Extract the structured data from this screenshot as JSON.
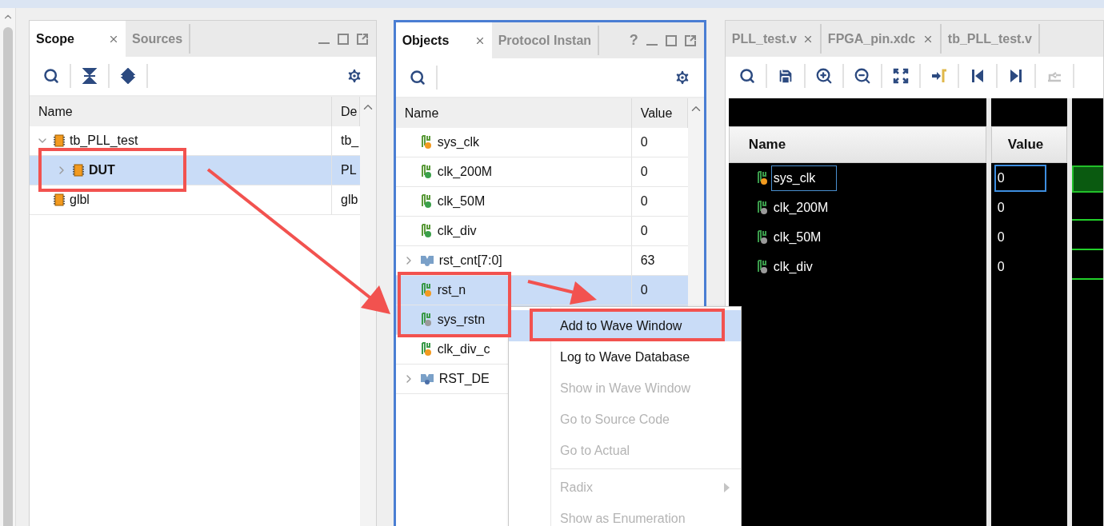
{
  "scope_panel": {
    "tabs": [
      {
        "label": "Scope",
        "selected": true,
        "closable": true
      },
      {
        "label": "Sources",
        "selected": false,
        "closable": false
      }
    ],
    "columns": [
      "Name",
      "De"
    ],
    "rows": [
      {
        "name": "tb_PLL_test",
        "design": "tb_",
        "selected": false,
        "expanded": true,
        "children": [
          {
            "name": "DUT",
            "design": "PL",
            "selected": true,
            "expanded": false
          }
        ]
      },
      {
        "name": "glbl",
        "design": "glb",
        "selected": false
      }
    ]
  },
  "objects_panel": {
    "tabs": [
      {
        "label": "Objects",
        "selected": true,
        "closable": true
      },
      {
        "label": "Protocol Instan",
        "selected": false,
        "closable": false
      }
    ],
    "help": "?",
    "columns": [
      "Name",
      "Value"
    ],
    "rows": [
      {
        "name": "sys_clk",
        "value": "0",
        "kind": "input",
        "selected": false
      },
      {
        "name": "clk_200M",
        "value": "0",
        "kind": "output",
        "selected": false
      },
      {
        "name": "clk_50M",
        "value": "0",
        "kind": "output",
        "selected": false
      },
      {
        "name": "clk_div",
        "value": "0",
        "kind": "output",
        "selected": false
      },
      {
        "name": "rst_cnt[7:0]",
        "value": "63",
        "kind": "bus",
        "selected": false,
        "expanded": false
      },
      {
        "name": "rst_n",
        "value": "0",
        "kind": "variable",
        "selected": true
      },
      {
        "name": "sys_rstn",
        "kind": "internal",
        "selected": true
      },
      {
        "name": "clk_div_c",
        "kind": "variable",
        "selected": false
      },
      {
        "name": "RST_DE",
        "kind": "module",
        "selected": false,
        "expanded": false
      }
    ]
  },
  "wave_panel": {
    "tabs": [
      {
        "label": "PLL_test.v",
        "selected": false,
        "closable": true
      },
      {
        "label": "FPGA_pin.xdc",
        "selected": false,
        "closable": true
      },
      {
        "label": "tb_PLL_test.v",
        "selected": false,
        "closable": false
      }
    ],
    "columns": [
      "Name",
      "Value"
    ],
    "signals": [
      {
        "name": "sys_clk",
        "value": "0",
        "kind": "variable",
        "selected": true
      },
      {
        "name": "clk_200M",
        "value": "0",
        "kind": "internal",
        "selected": false
      },
      {
        "name": "clk_50M",
        "value": "0",
        "kind": "internal",
        "selected": false
      },
      {
        "name": "clk_div",
        "value": "0",
        "kind": "internal",
        "selected": false
      }
    ]
  },
  "context_menu": {
    "items": [
      {
        "kind": "item",
        "label": "Add to Wave Window",
        "selected": true,
        "disabled": false
      },
      {
        "kind": "item",
        "label": "Log to Wave Database",
        "selected": false,
        "disabled": false
      },
      {
        "kind": "item",
        "label": "Show in Wave Window",
        "selected": false,
        "disabled": true
      },
      {
        "kind": "item",
        "label": "Go to Source Code",
        "selected": false,
        "disabled": true
      },
      {
        "kind": "item",
        "label": "Go to Actual",
        "selected": false,
        "disabled": true
      },
      {
        "kind": "separator"
      },
      {
        "kind": "submenu",
        "label": "Radix",
        "selected": false,
        "disabled": true
      },
      {
        "kind": "item",
        "label": "Show as Enumeration",
        "selected": false,
        "disabled": true
      }
    ]
  }
}
